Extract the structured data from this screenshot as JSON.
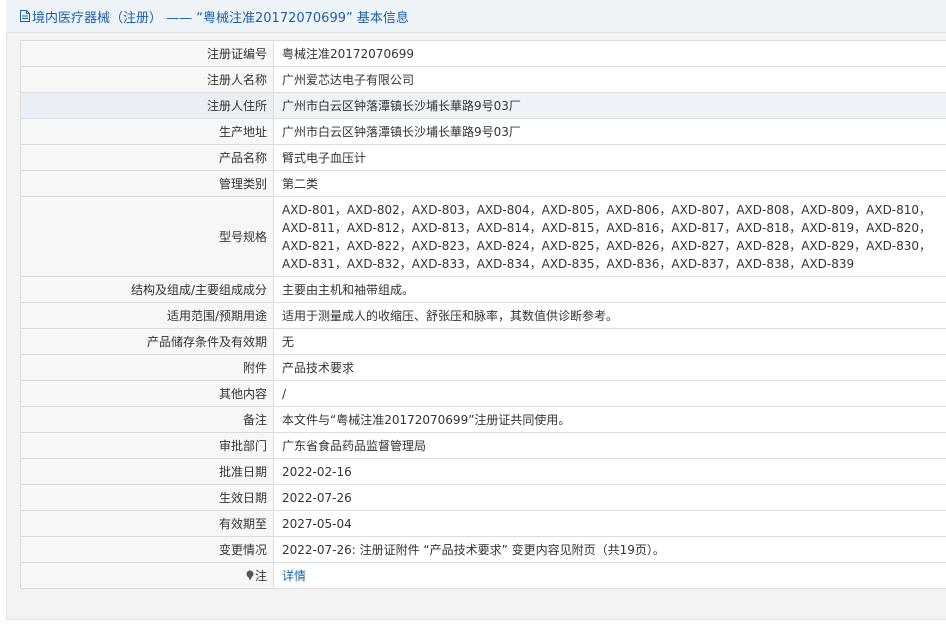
{
  "header": {
    "title": "境内医疗器械（注册） —— “粤械注准20172070699” 基本信息"
  },
  "rows": [
    {
      "label": "注册证编号",
      "value": "粤械注准20172070699"
    },
    {
      "label": "注册人名称",
      "value": "广州爱芯达电子有限公司"
    },
    {
      "label": "注册人住所",
      "value": "广州市白云区钟落潭镇长沙埔长華路9号03厂"
    },
    {
      "label": "生产地址",
      "value": "广州市白云区钟落潭镇长沙埔长華路9号03厂"
    },
    {
      "label": "产品名称",
      "value": "臂式电子血压计"
    },
    {
      "label": "管理类别",
      "value": "第二类"
    },
    {
      "label": "型号规格",
      "value": "AXD-801，AXD-802，AXD-803，AXD-804，AXD-805，AXD-806，AXD-807，AXD-808，AXD-809，AXD-810，AXD-811，AXD-812，AXD-813，AXD-814，AXD-815，AXD-816，AXD-817，AXD-818，AXD-819，AXD-820，AXD-821，AXD-822，AXD-823，AXD-824，AXD-825，AXD-826，AXD-827，AXD-828，AXD-829，AXD-830，AXD-831，AXD-832，AXD-833，AXD-834，AXD-835，AXD-836，AXD-837，AXD-838，AXD-839"
    },
    {
      "label": "结构及组成/主要组成成分",
      "value": "主要由主机和袖带组成。"
    },
    {
      "label": "适用范围/预期用途",
      "value": "适用于测量成人的收缩压、舒张压和脉率，其数值供诊断参考。"
    },
    {
      "label": "产品储存条件及有效期",
      "value": "无"
    },
    {
      "label": "附件",
      "value": "产品技术要求"
    },
    {
      "label": "其他内容",
      "value": "/"
    },
    {
      "label": "备注",
      "value": "本文件与“粤械注准20172070699”注册证共同使用。"
    },
    {
      "label": "审批部门",
      "value": "广东省食品药品监督管理局"
    },
    {
      "label": "批准日期",
      "value": "2022-02-16"
    },
    {
      "label": "生效日期",
      "value": "2022-07-26"
    },
    {
      "label": "有效期至",
      "value": "2027-05-04"
    },
    {
      "label": "变更情况",
      "value": "2022-07-26: 注册证附件 “产品技术要求” 变更内容见附页（共19页）。"
    },
    {
      "label": "注",
      "value": "详情"
    }
  ],
  "colors": {
    "title": "#1a61a8",
    "link": "#1a61a8",
    "highlight_row": "#eef3fa",
    "label_bg": "#f7f7f7",
    "border": "#dcdcdc"
  },
  "icons": {
    "title": "document-icon",
    "note": "pin-icon"
  }
}
